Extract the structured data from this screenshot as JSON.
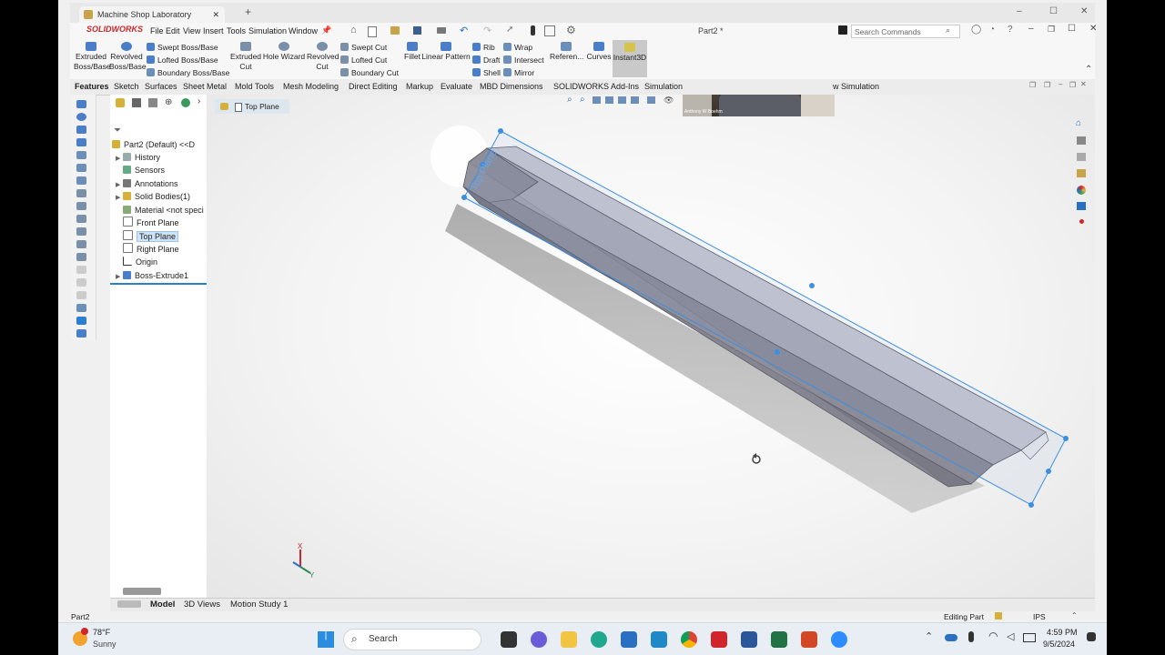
{
  "window": {
    "tab_title": "Machine Shop Laboratory",
    "new_tab": "+",
    "document_title": "Part2 *",
    "controls": [
      "–",
      "☐",
      "✕"
    ]
  },
  "app": {
    "logo": "SOLIDWORKS",
    "menu": [
      "File",
      "Edit",
      "View",
      "Insert",
      "Tools",
      "Simulation",
      "Window"
    ],
    "search_placeholder": "Search Commands"
  },
  "ribbon": {
    "large_buttons": [
      {
        "label": "Extruded\nBoss/Base",
        "icon": "extruded-boss-icon",
        "color": "#4a7ec8"
      },
      {
        "label": "Revolved\nBoss/Base",
        "icon": "revolved-boss-icon",
        "color": "#4a7ec8"
      },
      {
        "label": "Extruded\nCut",
        "icon": "extruded-cut-icon",
        "color": "#7a8fa8"
      },
      {
        "label": "Hole Wizard",
        "icon": "hole-wizard-icon",
        "color": "#7a8fa8"
      },
      {
        "label": "Revolved\nCut",
        "icon": "revolved-cut-icon",
        "color": "#7a8fa8"
      },
      {
        "label": "Fillet",
        "icon": "fillet-icon",
        "color": "#4a7ec8"
      },
      {
        "label": "Linear Pattern",
        "icon": "linear-pattern-icon",
        "color": "#4a7ec8"
      },
      {
        "label": "Referen...",
        "icon": "reference-geometry-icon",
        "color": "#6b8fb8"
      },
      {
        "label": "Curves",
        "icon": "curves-icon",
        "color": "#4a7ec8"
      },
      {
        "label": "Instant3D",
        "icon": "instant3d-icon",
        "color": "#d6c34a"
      }
    ],
    "small_buttons": [
      {
        "label": "Swept Boss/Base",
        "icon": "swept-boss-icon"
      },
      {
        "label": "Lofted Boss/Base",
        "icon": "lofted-boss-icon"
      },
      {
        "label": "Boundary Boss/Base",
        "icon": "boundary-boss-icon"
      },
      {
        "label": "Swept Cut",
        "icon": "swept-cut-icon"
      },
      {
        "label": "Lofted Cut",
        "icon": "lofted-cut-icon"
      },
      {
        "label": "Boundary Cut",
        "icon": "boundary-cut-icon"
      },
      {
        "label": "Rib",
        "icon": "rib-icon"
      },
      {
        "label": "Draft",
        "icon": "draft-icon"
      },
      {
        "label": "Shell",
        "icon": "shell-icon"
      },
      {
        "label": "Wrap",
        "icon": "wrap-icon"
      },
      {
        "label": "Intersect",
        "icon": "intersect-icon"
      },
      {
        "label": "Mirror",
        "icon": "mirror-icon"
      }
    ]
  },
  "command_tabs": [
    "Features",
    "Sketch",
    "Surfaces",
    "Sheet Metal",
    "Mold Tools",
    "Mesh Modeling",
    "Direct Editing",
    "Markup",
    "Evaluate",
    "MBD Dimensions",
    "SOLIDWORKS Add-Ins",
    "Simulation",
    "w Simulation"
  ],
  "breadcrumb": {
    "label": "Top Plane"
  },
  "feature_tree": {
    "root": "Part2 (Default) <<D",
    "items": [
      {
        "label": "History",
        "expandable": true
      },
      {
        "label": "Sensors",
        "expandable": false
      },
      {
        "label": "Annotations",
        "expandable": true
      },
      {
        "label": "Solid Bodies(1)",
        "expandable": true
      },
      {
        "label": "Material <not speci",
        "expandable": false
      },
      {
        "label": "Front Plane",
        "expandable": false
      },
      {
        "label": "Top Plane",
        "expandable": false,
        "selected": true
      },
      {
        "label": "Right Plane",
        "expandable": false
      },
      {
        "label": "Origin",
        "expandable": false
      },
      {
        "label": "Boss-Extrude1",
        "expandable": true
      }
    ]
  },
  "viewport": {
    "plane_label": "Top Plane",
    "triad": {
      "x": "X",
      "y": "Y"
    }
  },
  "webcam": {
    "name": "Anthony W Boehm"
  },
  "bottom_tabs": [
    "Model",
    "3D Views",
    "Motion Study 1"
  ],
  "status": {
    "left": "Part2",
    "editing": "Editing Part",
    "units": "IPS"
  },
  "taskbar": {
    "weather_temp": "78°F",
    "weather_cond": "Sunny",
    "search": "Search",
    "time": "4:59 PM",
    "date": "9/5/2024"
  },
  "colors": {
    "accent": "#2a7fd4",
    "selection": "#3d8fe0",
    "body_face_top": "#c8c8d2",
    "body_face_side": "#9c9ca8",
    "body_face_dark": "#7d7d89",
    "brand_red": "#d0262b"
  }
}
